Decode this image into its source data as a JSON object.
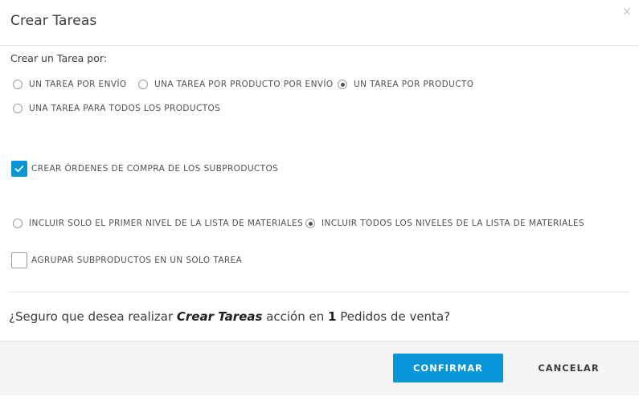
{
  "dialog": {
    "title": "Crear Tareas",
    "close_glyph": "×"
  },
  "create_by": {
    "label": "Crear un Tarea por:",
    "options": [
      {
        "label": "UN TAREA POR ENVÍO",
        "selected": false
      },
      {
        "label": "UNA TAREA POR PRODUCTO POR ENVÍO",
        "selected": false
      },
      {
        "label": "UN TAREA POR PRODUCTO",
        "selected": true
      },
      {
        "label": "UNA TAREA PARA TODOS LOS PRODUCTOS",
        "selected": false
      }
    ]
  },
  "purchase_orders": {
    "label": "CREAR ÓRDENES DE COMPRA DE LOS SUBPRODUCTOS",
    "checked": true
  },
  "bom_levels": {
    "options": [
      {
        "label": "INCLUIR SOLO EL PRIMER NIVEL DE LA LISTA DE MATERIALES",
        "selected": false
      },
      {
        "label": "INCLUIR TODOS LOS NIVELES DE LA LISTA DE MATERIALES",
        "selected": true
      }
    ]
  },
  "group_subproducts": {
    "label": "AGRUPAR SUBPRODUCTOS EN UN SOLO TAREA",
    "checked": false
  },
  "confirmation": {
    "prefix": "¿Seguro que desea realizar ",
    "action": "Crear Tareas",
    "middle": " acción en ",
    "count": "1",
    "suffix": " Pedidos de venta?"
  },
  "footer": {
    "confirm_label": "CONFIRMAR",
    "cancel_label": "CANCELAR"
  },
  "colors": {
    "accent": "#0696d7",
    "footer_bg": "#f5f5f5",
    "text": "#3c3c3c"
  },
  "icons": {
    "close": "close-icon",
    "check": "checkmark-icon"
  }
}
